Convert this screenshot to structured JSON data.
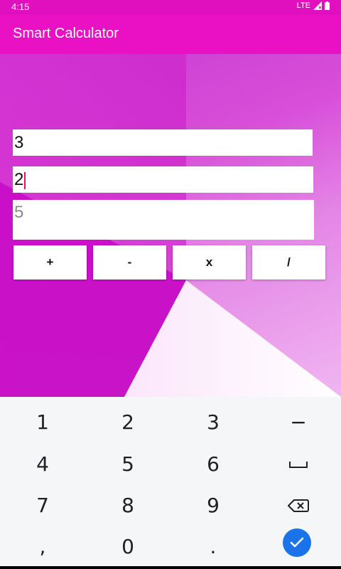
{
  "status_bar": {
    "time": "4:15",
    "network": "LTE"
  },
  "app": {
    "title": "Smart Calculator"
  },
  "inputs": {
    "first_number": "3",
    "second_number": "2",
    "result": "5"
  },
  "operators": {
    "add": "+",
    "subtract": "-",
    "multiply": "x",
    "divide": "/"
  },
  "keyboard": {
    "row1": [
      "1",
      "2",
      "3",
      "−"
    ],
    "row2": [
      "4",
      "5",
      "6"
    ],
    "row3": [
      "7",
      "8",
      "9"
    ],
    "row4": [
      ",",
      "0",
      "."
    ],
    "icons": {
      "space": "space-icon",
      "backspace": "backspace-icon",
      "done": "checkmark-icon"
    }
  },
  "colors": {
    "status_bar": "#e010be",
    "app_bar": "#ea11c5",
    "caret": "#e0106e",
    "done_key": "#1a73e8"
  }
}
